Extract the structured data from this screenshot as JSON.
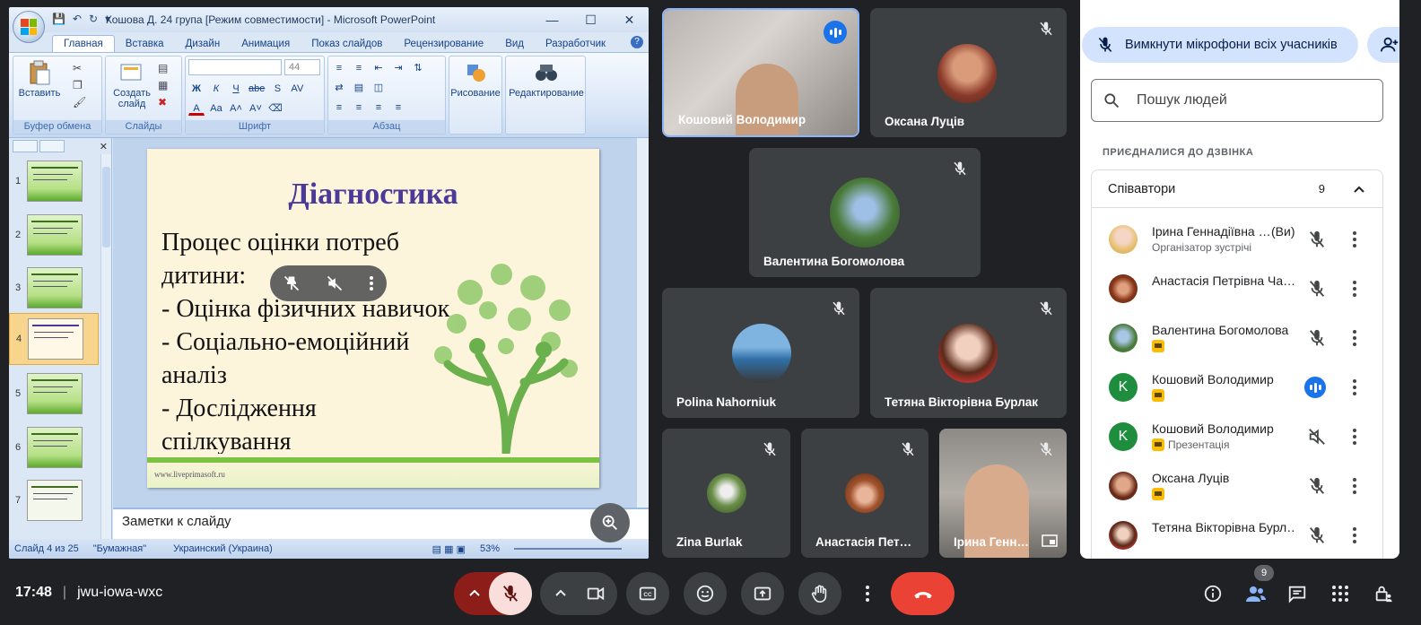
{
  "ppt": {
    "title": "Кошова Д. 24 група [Режим совместимости] - Microsoft PowerPoint",
    "tabs": [
      "Главная",
      "Вставка",
      "Дизайн",
      "Анимация",
      "Показ слайдов",
      "Рецензирование",
      "Вид",
      "Разработчик"
    ],
    "groups": {
      "clipboard": "Буфер обмена",
      "slides": "Слайды",
      "font": "Шрифт",
      "paragraph": "Абзац"
    },
    "buttons": {
      "paste": "Вставить",
      "new_slide": "Создать слайд",
      "drawing": "Рисование",
      "editing": "Редактирование"
    },
    "font_size": "44",
    "thumbnails": [
      "1",
      "2",
      "3",
      "4",
      "5",
      "6",
      "7"
    ],
    "slide": {
      "title": "Діагностика",
      "lines": [
        "Процес оцінки потреб",
        "дитини:",
        "- Оцінка фізичних навичок",
        "- Соціально-емоційний",
        "аналіз",
        "- Дослідження",
        "спілкування"
      ],
      "url": "www.liveprimasoft.ru"
    },
    "notes_placeholder": "Заметки к слайду",
    "status": {
      "slide_count": "Слайд 4 из 25",
      "theme": "\"Бумажная\"",
      "language": "Украинский (Украина)",
      "zoom": "53%"
    }
  },
  "tiles": [
    {
      "name": "Кошовий Володимир"
    },
    {
      "name": "Оксана Луців"
    },
    {
      "name": "Валентина Богомолова"
    },
    {
      "name": "Polina Nahorniuk"
    },
    {
      "name": "Тетяна Вікторівна Бурлак"
    },
    {
      "name": "Zina Burlak"
    },
    {
      "name": "Анастасія Пет…"
    },
    {
      "name": "Ірина Генн…"
    }
  ],
  "panel": {
    "mute_all": "Вимкнути мікрофони всіх учасників",
    "search_placeholder": "Пошук людей",
    "joined_label": "ПРИЄДНАЛИСЯ ДО ДЗВІНКА",
    "group_label": "Співавтори",
    "group_count": "9",
    "people": [
      {
        "name": "Ірина Геннадіївна …",
        "you": "(Ви)",
        "sub": "Організатор зустрічі",
        "badge": false,
        "avatar_letter": ""
      },
      {
        "name": "Анастасія Петрівна Ча…",
        "sub": "",
        "badge": false,
        "avatar_letter": ""
      },
      {
        "name": "Валентина Богомолова",
        "sub": "",
        "badge": true,
        "avatar_letter": ""
      },
      {
        "name": "Кошовий Володимир",
        "sub": "",
        "badge": true,
        "avatar_letter": "K"
      },
      {
        "name": "Кошовий Володимир",
        "sub": "Презентація",
        "badge": true,
        "avatar_letter": "K"
      },
      {
        "name": "Оксана Луців",
        "sub": "",
        "badge": true,
        "avatar_letter": ""
      },
      {
        "name": "Тетяна Вікторівна Бурл…",
        "sub": "",
        "badge": false,
        "avatar_letter": ""
      }
    ]
  },
  "bottom": {
    "time": "17:48",
    "meeting_code": "jwu-iowa-wxc",
    "people_count": "9"
  },
  "colors": {
    "meet_bg": "#202124",
    "tile_bg": "#3c4043",
    "accent_blue": "#1a73e8",
    "end_call_red": "#ea4335",
    "muted_mic_bg": "#f9dedc",
    "avatar_green": "#1e8e3e"
  }
}
